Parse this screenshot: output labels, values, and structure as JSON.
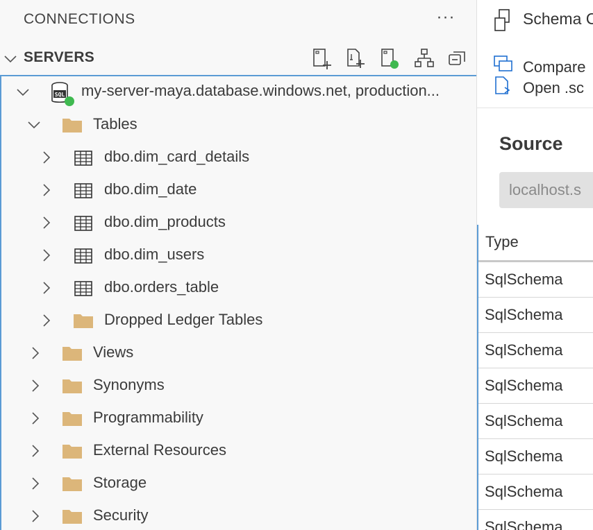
{
  "sidebar": {
    "connections_title": "CONNECTIONS",
    "more_label": "···",
    "servers_title": "SERVERS",
    "toolbar": [
      "new-connection-icon",
      "new-query-icon",
      "active-connections-icon",
      "group-icon",
      "collapse-all-icon"
    ],
    "server": {
      "label": "my-server-maya.database.windows.net, production...",
      "status_color": "#3fb950"
    },
    "tables_folder": "Tables",
    "tables": [
      "dbo.dim_card_details",
      "dbo.dim_date",
      "dbo.dim_products",
      "dbo.dim_users",
      "dbo.orders_table"
    ],
    "dropped_ledger": "Dropped Ledger Tables",
    "folders": [
      "Views",
      "Synonyms",
      "Programmability",
      "External Resources",
      "Storage",
      "Security"
    ],
    "folder_color": "#dcb67a"
  },
  "right_panel": {
    "title": "Schema C",
    "tools": [
      "Compare",
      "Open .sc"
    ],
    "source_label": "Source",
    "source_value": "localhost.s",
    "grid_header": "Type",
    "grid_rows": [
      "SqlSchema",
      "SqlSchema",
      "SqlSchema",
      "SqlSchema",
      "SqlSchema",
      "SqlSchema",
      "SqlSchema",
      "SqlSchema"
    ]
  }
}
